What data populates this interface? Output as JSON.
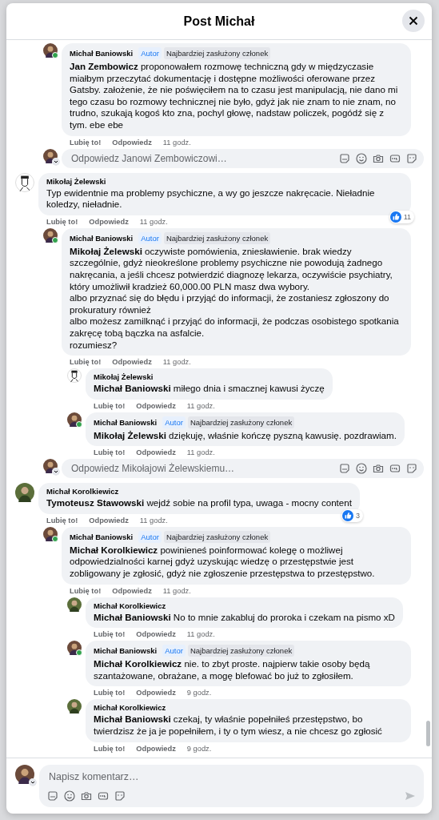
{
  "dialog": {
    "title": "Post Michał"
  },
  "threads": [
    {
      "replies": [
        {
          "author": "Michał Baniowski",
          "avatar": {
            "kind": "cartoon",
            "online": true
          },
          "badges": [
            {
              "kind": "author",
              "label": "Autor"
            },
            {
              "kind": "member",
              "label": "Najbardziej zasłużony członek"
            }
          ],
          "text": "**Jan Zembowicz** proponowałem rozmowę techniczną gdy w międzyczasie miałbym przeczytać dokumentację i dostępne możliwości oferowane przez Gatsby. założenie, że nie poświęciłem na to czasu jest manipulacją, nie dano mi tego czasu bo rozmowy technicznej nie było, gdyż jak nie znam to nie znam, no trudno, szukają kogoś kto zna, pochyl głowę, nadstaw policzek, pogódź się z tym. ebe ebe",
          "like": "Lubię to!",
          "reply": "Odpowiedz",
          "time": "11 godz."
        }
      ],
      "reply_box": {
        "placeholder": "Odpowiedz Janowi Zembowiczowi…"
      }
    },
    {
      "comment": {
        "author": "Mikołaj Żelewski",
        "avatar": {
          "kind": "sketch",
          "online": false
        },
        "text": "Typ ewidentnie ma problemy psychiczne, a wy go jeszcze nakręcacie. Nieładnie koledzy, nieładnie.",
        "like": "Lubię to!",
        "reply": "Odpowiedz",
        "time": "11 godz.",
        "reactions": "11"
      },
      "replies": [
        {
          "author": "Michał Baniowski",
          "avatar": {
            "kind": "cartoon",
            "online": true
          },
          "badges": [
            {
              "kind": "author",
              "label": "Autor"
            },
            {
              "kind": "member",
              "label": "Najbardziej zasłużony członek"
            }
          ],
          "text": "**Mikołaj Żelewski** oczywiste pomówienia, zniesławienie. brak wiedzy szczególnie, gdyż nieokreślone problemy psychiczne nie powodują żadnego nakręcania, a jeśli chcesz potwierdzić diagnozę lekarza, oczywiście psychiatry, który umożliwił kradzież 60,000.00 PLN masz dwa wybory.\nalbo przyznać się do błędu i przyjąć do informacji, że zostaniesz zgłoszony do prokuratury również\nalbo możesz zamilknąć i przyjąć do informacji, że podczas osobistego spotkania zakręcę tobą bączka na asfalcie.\nrozumiesz?",
          "like": "Lubię to!",
          "reply": "Odpowiedz",
          "time": "11 godz.",
          "replies": [
            {
              "author": "Mikołaj Żelewski",
              "avatar": {
                "kind": "sketch",
                "online": false
              },
              "text": "**Michał Baniowski** miłego dnia i smacznej kawusi życzę",
              "like": "Lubię to!",
              "reply": "Odpowiedz",
              "time": "11 godz."
            },
            {
              "author": "Michał Baniowski",
              "avatar": {
                "kind": "cartoon",
                "online": true
              },
              "badges": [
                {
                  "kind": "author",
                  "label": "Autor"
                },
                {
                  "kind": "member",
                  "label": "Najbardziej zasłużony członek"
                }
              ],
              "text": "**Mikołaj Żelewski** dziękuję, właśnie kończę pyszną kawusię. pozdrawiam.",
              "like": "Lubię to!",
              "reply": "Odpowiedz",
              "time": "11 godz."
            }
          ]
        }
      ],
      "reply_box": {
        "placeholder": "Odpowiedz Mikołajowi Żelewskiemu…"
      }
    },
    {
      "comment": {
        "author": "Michał Korolkiewicz",
        "avatar": {
          "kind": "photo",
          "online": false
        },
        "text": "**Tymoteusz Stawowski** wejdź sobie na profil typa, uwaga - mocny content",
        "like": "Lubię to!",
        "reply": "Odpowiedz",
        "time": "11 godz.",
        "reactions": "3"
      },
      "replies": [
        {
          "author": "Michał Baniowski",
          "avatar": {
            "kind": "cartoon",
            "online": true
          },
          "badges": [
            {
              "kind": "author",
              "label": "Autor"
            },
            {
              "kind": "member",
              "label": "Najbardziej zasłużony członek"
            }
          ],
          "text": "**Michał Korolkiewicz** powinieneś poinformować kolegę o możliwej odpowiedzialności karnej gdyż uzyskując wiedzę o przestępstwie jest zobligowany je zgłosić, gdyż nie zgłoszenie przestępstwa to przestępstwo.",
          "like": "Lubię to!",
          "reply": "Odpowiedz",
          "time": "11 godz.",
          "replies": [
            {
              "author": "Michał Korolkiewicz",
              "avatar": {
                "kind": "photo",
                "online": false
              },
              "text": "**Michał Baniowski** No to mnie zakabluj do proroka i czekam na pismo xD",
              "like": "Lubię to!",
              "reply": "Odpowiedz",
              "time": "11 godz."
            },
            {
              "author": "Michał Baniowski",
              "avatar": {
                "kind": "cartoon",
                "online": true
              },
              "badges": [
                {
                  "kind": "author",
                  "label": "Autor"
                },
                {
                  "kind": "member",
                  "label": "Najbardziej zasłużony członek"
                }
              ],
              "text": "**Michał Korolkiewicz** nie. to zbyt proste. najpierw takie osoby będą szantażowane, obrażane, a mogę blefować bo już to zgłosiłem.",
              "like": "Lubię to!",
              "reply": "Odpowiedz",
              "time": "9 godz."
            },
            {
              "author": "Michał Korolkiewicz",
              "avatar": {
                "kind": "photo",
                "online": false
              },
              "text": "**Michał Baniowski** czekaj, ty właśnie popełniłeś przestępstwo, bo twierdzisz że ja je popełniłem, i ty o tym wiesz, a nie chcesz go zgłosić",
              "like": "Lubię to!",
              "reply": "Odpowiedz",
              "time": "9 godz."
            }
          ]
        }
      ]
    }
  ],
  "composer": {
    "placeholder": "Napisz komentarz…"
  }
}
